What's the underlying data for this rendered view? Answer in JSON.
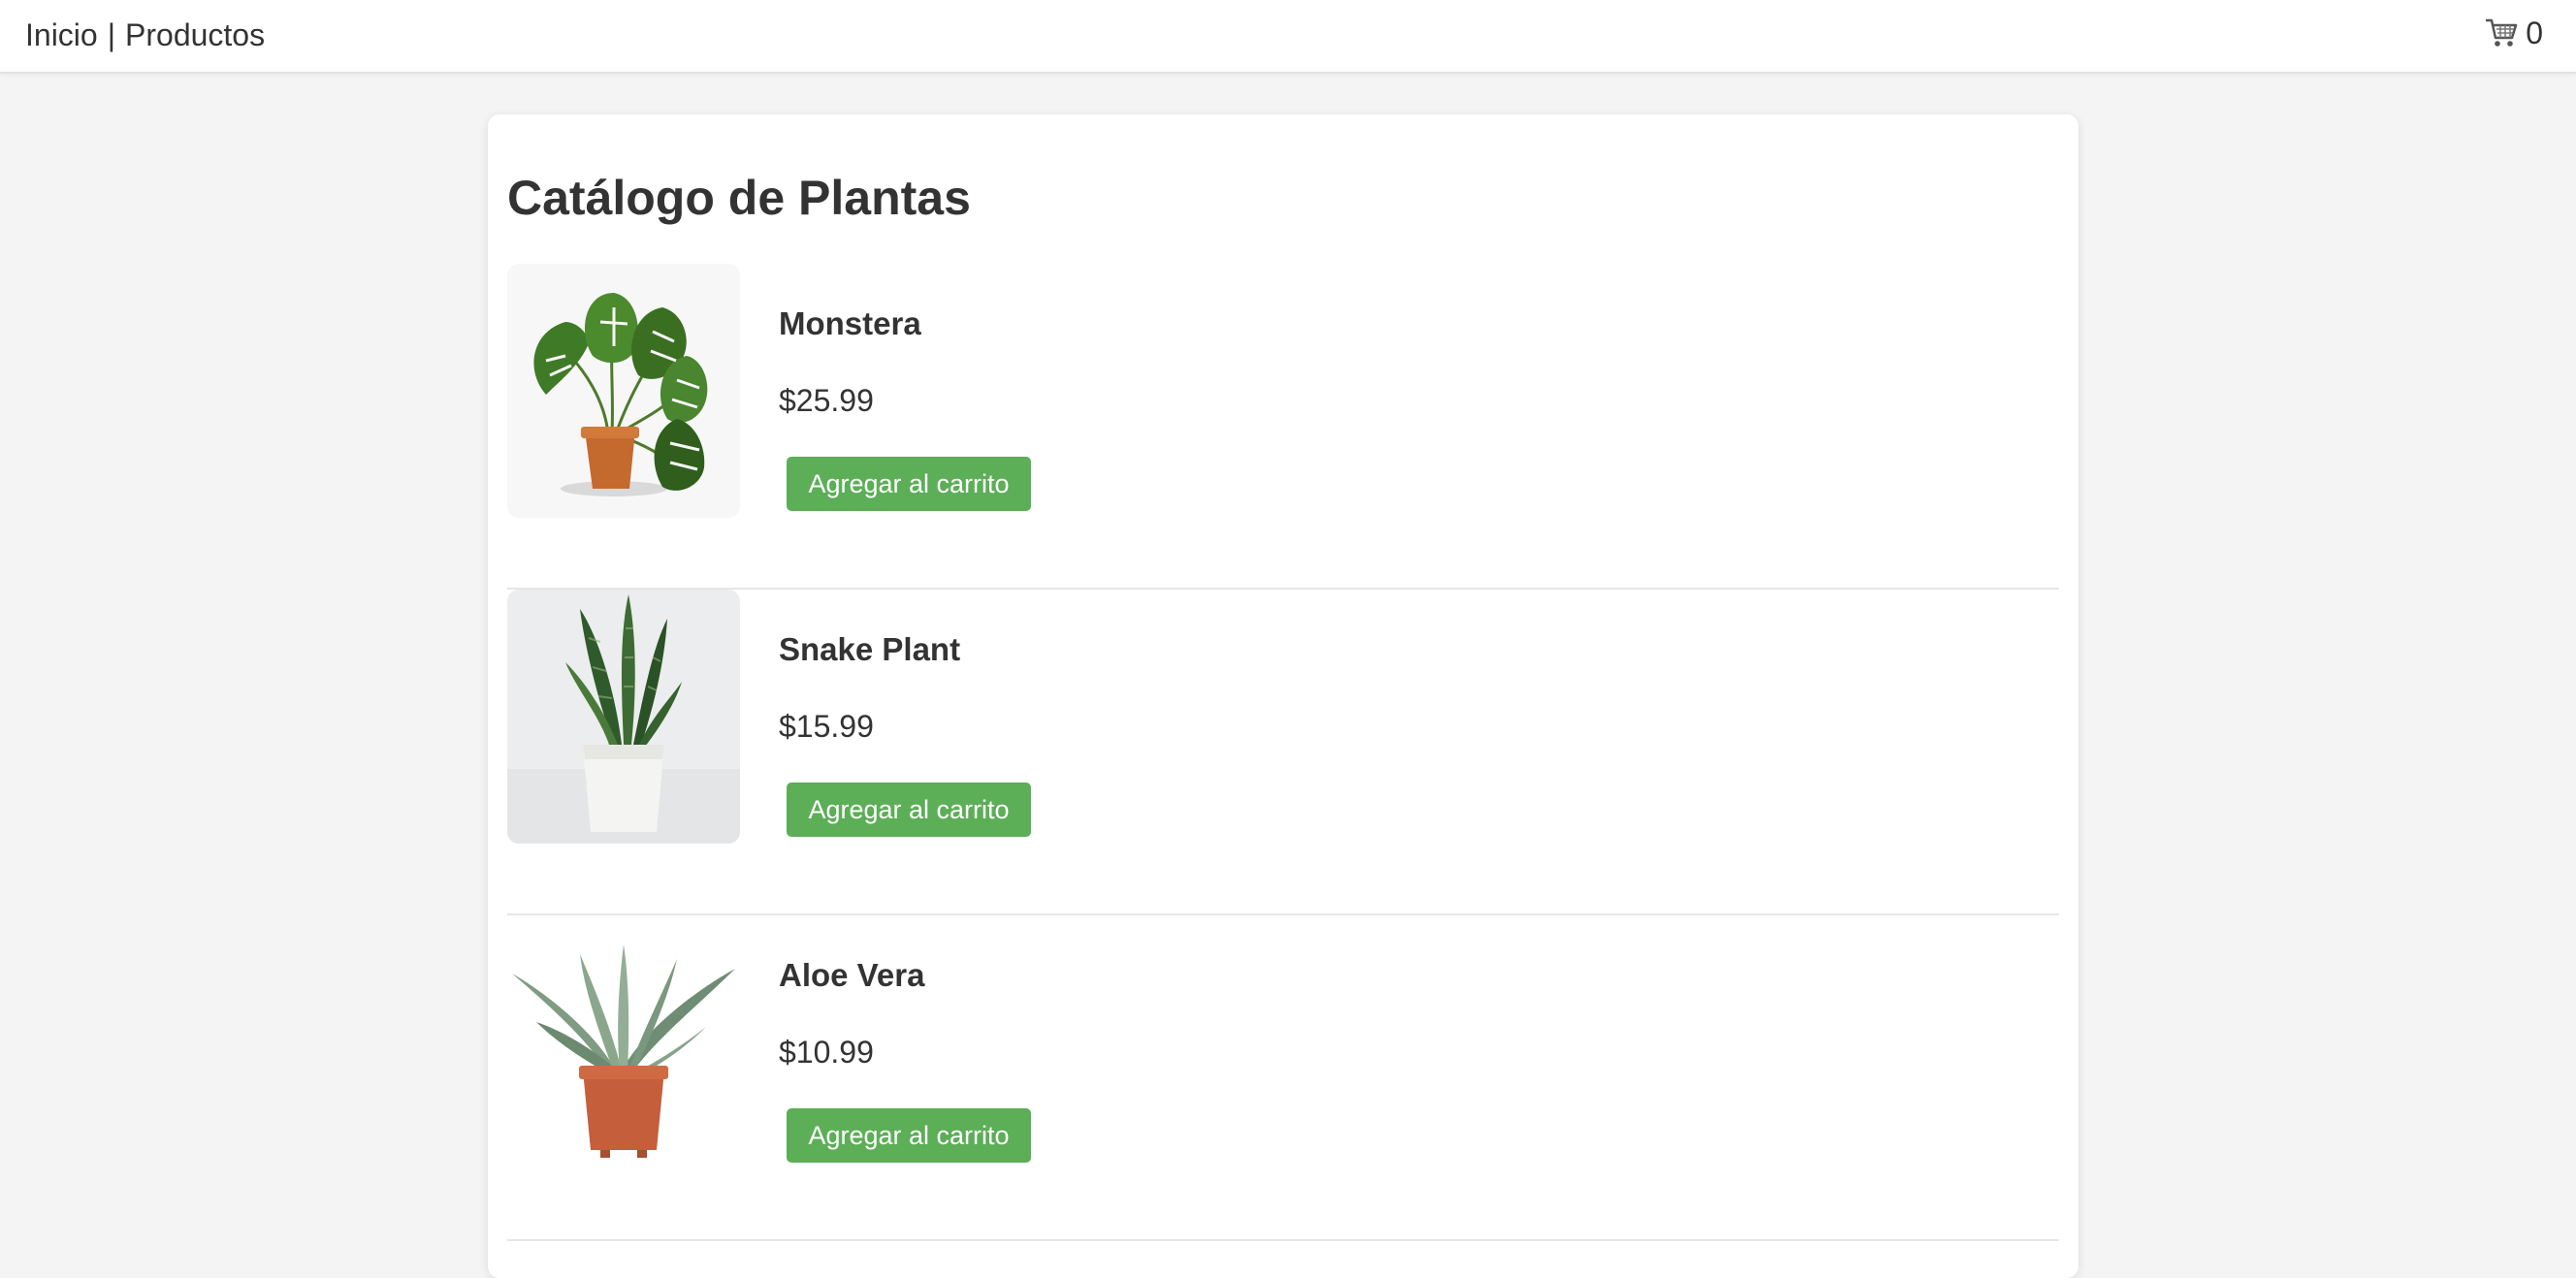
{
  "header": {
    "nav_home": "Inicio",
    "nav_separator": "|",
    "nav_products": "Productos",
    "cart_icon": "cart-icon",
    "cart_count": "0"
  },
  "catalog": {
    "title": "Catálogo de Plantas",
    "products": [
      {
        "name": "Monstera",
        "price": "$25.99",
        "button_label": "Agregar al carrito",
        "image": "monstera-photo"
      },
      {
        "name": "Snake Plant",
        "price": "$15.99",
        "button_label": "Agregar al carrito",
        "image": "snake-plant-photo"
      },
      {
        "name": "Aloe Vera",
        "price": "$10.99",
        "button_label": "Agregar al carrito",
        "image": "aloe-vera-photo"
      }
    ]
  },
  "colors": {
    "button_green": "#5cae57",
    "page_background": "#f4f4f4",
    "text": "#333333"
  }
}
